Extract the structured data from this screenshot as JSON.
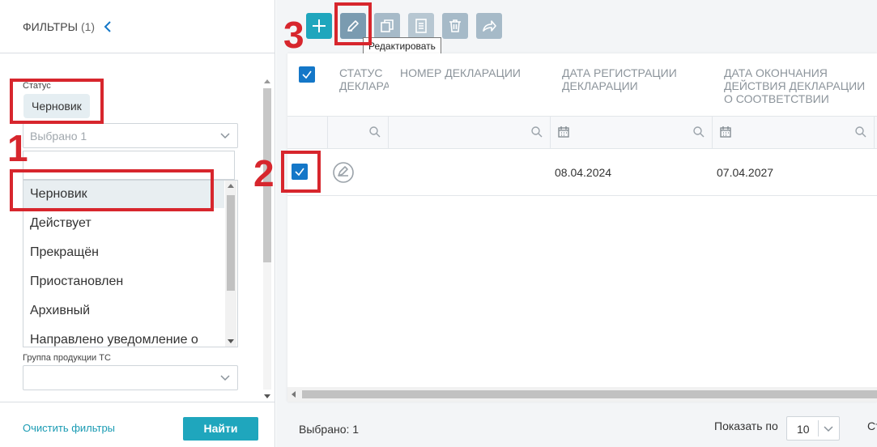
{
  "filters": {
    "title": "ФИЛЬТРЫ",
    "count": "(1)",
    "status": {
      "label": "Статус",
      "chip": "Черновик",
      "placeholder": "Выбрано 1",
      "options": [
        "Черновик",
        "Действует",
        "Прекращён",
        "Приостановлен",
        "Архивный",
        "Направлено уведомление о"
      ],
      "selected_option": "Черновик"
    },
    "group": {
      "label": "Группа продукции ТС"
    },
    "clear_label": "Очистить фильтры",
    "find_label": "Найти"
  },
  "toolbar": {
    "add_icon": "plus-icon",
    "edit_icon": "pencil-icon",
    "copy_icon": "copy-icon",
    "doc_icon": "document-icon",
    "delete_icon": "trash-icon",
    "share_icon": "share-arrow-icon",
    "tooltip": "Редактировать"
  },
  "table": {
    "columns": [
      "СТАТУС ДЕКЛАРАЦИИ",
      "НОМЕР ДЕКЛАРАЦИИ",
      "ДАТА РЕГИСТРАЦИИ ДЕКЛАРАЦИИ",
      "ДАТА ОКОНЧАНИЯ ДЕЙСТВИЯ ДЕКЛАРАЦИИ О СООТВЕТСТВИИ"
    ],
    "rows": [
      {
        "status_icon": "draft-status-icon",
        "number": "",
        "reg_date": "08.04.2024",
        "end_date": "07.04.2027",
        "checked": true
      }
    ]
  },
  "footer": {
    "selected": "Выбрано: 1",
    "page_size_label": "Показать по",
    "page_size": "10",
    "extra": "Ст"
  },
  "annotations": {
    "n1": "1",
    "n2": "2",
    "n3": "3"
  },
  "colors": {
    "accent": "#1fa6bd",
    "checkbox": "#1477c8",
    "annotation": "#d7262d"
  }
}
